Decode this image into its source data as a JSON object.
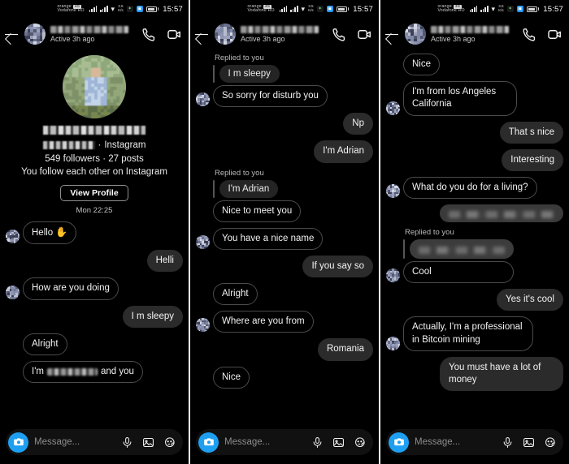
{
  "app": {
    "name": "Messenger",
    "accent_color": "#1e9ff2",
    "background_color": "#000000",
    "bubble_in_color": "#000000",
    "bubble_out_color": "#2b2b2b",
    "quote_color": "#242424"
  },
  "status_bar": {
    "carrier_line1": "orange",
    "carrier_line2": "Vodafone RO",
    "sim_badge": "4G",
    "data_rate_value": "3.5",
    "data_rate_unit": "K/s",
    "clock": "15:57",
    "icons": [
      "signal-bars",
      "signal-bars",
      "wifi",
      "data-rate",
      "shield",
      "app-badge",
      "battery"
    ]
  },
  "header": {
    "contact_name_redacted": true,
    "status": "Active 3h ago",
    "back_label": "Back",
    "call_label": "Audio call",
    "video_label": "Video call"
  },
  "profile": {
    "name_redacted": true,
    "username_redacted": true,
    "platform": "Instagram",
    "separator": "·",
    "stats": "549 followers · 27 posts",
    "mutual": "You follow each other on Instagram",
    "view_profile_label": "View Profile"
  },
  "composer": {
    "placeholder": "Message...",
    "icons": [
      "camera-icon",
      "microphone-icon",
      "image-icon",
      "sticker-icon"
    ]
  },
  "panels": [
    {
      "id": "panel-1",
      "day_stamp": "Mon 22:25",
      "messages": [
        {
          "side": "in",
          "text": "Hello",
          "emoji": "✋",
          "avatar": true
        },
        {
          "side": "out",
          "text": "Helli"
        },
        {
          "side": "in",
          "text": "How are you doing",
          "avatar": true
        },
        {
          "side": "out",
          "text": "I m sleepy"
        },
        {
          "side": "in",
          "text": "Alright"
        },
        {
          "side": "in",
          "text": "I'm",
          "redacted_inline": true,
          "text_after": "and you",
          "avatar": true,
          "clipped": true
        }
      ]
    },
    {
      "id": "panel-2",
      "messages": [
        {
          "side": "in",
          "reply_label": "Replied to you",
          "quoted": "I m sleepy",
          "text": "So sorry for disturb you",
          "avatar": true
        },
        {
          "side": "out",
          "text": "Np"
        },
        {
          "side": "out",
          "text": "I'm Adrian"
        },
        {
          "side": "in",
          "reply_label": "Replied to you",
          "quoted": "I'm Adrian",
          "text": "Nice to meet you"
        },
        {
          "side": "in",
          "text": "You have a nice name",
          "avatar": true
        },
        {
          "side": "out",
          "text": "If you say so"
        },
        {
          "side": "in",
          "text": "Alright"
        },
        {
          "side": "in",
          "text": "Where are you from",
          "avatar": true
        },
        {
          "side": "out",
          "text": "Romania"
        },
        {
          "side": "in",
          "text": "Nice",
          "clipped": true
        }
      ]
    },
    {
      "id": "panel-3",
      "messages": [
        {
          "side": "in",
          "text": "Nice"
        },
        {
          "side": "in",
          "text": "I'm from los Angeles California",
          "avatar": true
        },
        {
          "side": "out",
          "text": "That s nice"
        },
        {
          "side": "out",
          "text": "Interesting"
        },
        {
          "side": "in",
          "text": "What do you do for a living?",
          "avatar": true
        },
        {
          "side": "out",
          "redacted": true
        },
        {
          "side": "in",
          "reply_label": "Replied to you",
          "quoted_redacted": true,
          "text": "Cool",
          "avatar": true
        },
        {
          "side": "out",
          "text": "Yes it's cool"
        },
        {
          "side": "in",
          "text": "Actually, I'm a professional in Bitcoin mining",
          "avatar": true
        },
        {
          "side": "out",
          "text": "You must have a lot of money",
          "clipped": true
        }
      ]
    }
  ]
}
